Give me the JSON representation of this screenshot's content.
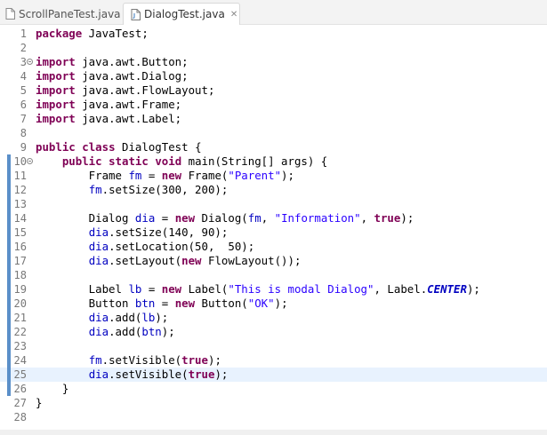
{
  "tabs": [
    {
      "label": "ScrollPaneTest.java",
      "active": false
    },
    {
      "label": "DialogTest.java",
      "active": true,
      "close_icon": "close-x-icon"
    }
  ],
  "editor": {
    "current_line": 25,
    "modified_lines": [
      10,
      26
    ],
    "folding_lines": [
      3,
      10
    ],
    "lines": [
      {
        "n": "1",
        "tokens": [
          [
            "kw",
            "package"
          ],
          [
            "p",
            " JavaTest;"
          ]
        ]
      },
      {
        "n": "2",
        "tokens": []
      },
      {
        "n": "3",
        "tokens": [
          [
            "kw",
            "import"
          ],
          [
            "p",
            " java.awt.Button;"
          ]
        ]
      },
      {
        "n": "4",
        "tokens": [
          [
            "kw",
            "import"
          ],
          [
            "p",
            " java.awt.Dialog;"
          ]
        ]
      },
      {
        "n": "5",
        "tokens": [
          [
            "kw",
            "import"
          ],
          [
            "p",
            " java.awt.FlowLayout;"
          ]
        ]
      },
      {
        "n": "6",
        "tokens": [
          [
            "kw",
            "import"
          ],
          [
            "p",
            " java.awt.Frame;"
          ]
        ]
      },
      {
        "n": "7",
        "tokens": [
          [
            "kw",
            "import"
          ],
          [
            "p",
            " java.awt.Label;"
          ]
        ]
      },
      {
        "n": "8",
        "tokens": []
      },
      {
        "n": "9",
        "tokens": [
          [
            "kw",
            "public"
          ],
          [
            "p",
            " "
          ],
          [
            "kw",
            "class"
          ],
          [
            "p",
            " DialogTest {"
          ]
        ]
      },
      {
        "n": "10",
        "tokens": [
          [
            "p",
            "    "
          ],
          [
            "kw",
            "public"
          ],
          [
            "p",
            " "
          ],
          [
            "kw",
            "static"
          ],
          [
            "p",
            " "
          ],
          [
            "kw",
            "void"
          ],
          [
            "p",
            " main(String[] args) {"
          ]
        ]
      },
      {
        "n": "11",
        "tokens": [
          [
            "p",
            "        Frame "
          ],
          [
            "fld",
            "fm"
          ],
          [
            "p",
            " = "
          ],
          [
            "kw",
            "new"
          ],
          [
            "p",
            " Frame("
          ],
          [
            "str",
            "\"Parent\""
          ],
          [
            "p",
            ");"
          ]
        ]
      },
      {
        "n": "12",
        "tokens": [
          [
            "p",
            "        "
          ],
          [
            "fld",
            "fm"
          ],
          [
            "p",
            ".setSize(300, 200);"
          ]
        ]
      },
      {
        "n": "13",
        "tokens": []
      },
      {
        "n": "14",
        "tokens": [
          [
            "p",
            "        Dialog "
          ],
          [
            "fld",
            "dia"
          ],
          [
            "p",
            " = "
          ],
          [
            "kw",
            "new"
          ],
          [
            "p",
            " Dialog("
          ],
          [
            "fld",
            "fm"
          ],
          [
            "p",
            ", "
          ],
          [
            "str",
            "\"Information\""
          ],
          [
            "p",
            ", "
          ],
          [
            "kw",
            "true"
          ],
          [
            "p",
            ");"
          ]
        ]
      },
      {
        "n": "15",
        "tokens": [
          [
            "p",
            "        "
          ],
          [
            "fld",
            "dia"
          ],
          [
            "p",
            ".setSize(140, 90);"
          ]
        ]
      },
      {
        "n": "16",
        "tokens": [
          [
            "p",
            "        "
          ],
          [
            "fld",
            "dia"
          ],
          [
            "p",
            ".setLocation(50,  50);"
          ]
        ]
      },
      {
        "n": "17",
        "tokens": [
          [
            "p",
            "        "
          ],
          [
            "fld",
            "dia"
          ],
          [
            "p",
            ".setLayout("
          ],
          [
            "kw",
            "new"
          ],
          [
            "p",
            " FlowLayout());"
          ]
        ]
      },
      {
        "n": "18",
        "tokens": []
      },
      {
        "n": "19",
        "tokens": [
          [
            "p",
            "        Label "
          ],
          [
            "fld",
            "lb"
          ],
          [
            "p",
            " = "
          ],
          [
            "kw",
            "new"
          ],
          [
            "p",
            " Label("
          ],
          [
            "str",
            "\"This is modal Dialog\""
          ],
          [
            "p",
            ", Label."
          ],
          [
            "sfld",
            "CENTER"
          ],
          [
            "p",
            ");"
          ]
        ]
      },
      {
        "n": "20",
        "tokens": [
          [
            "p",
            "        Button "
          ],
          [
            "fld",
            "btn"
          ],
          [
            "p",
            " = "
          ],
          [
            "kw",
            "new"
          ],
          [
            "p",
            " Button("
          ],
          [
            "str",
            "\"OK\""
          ],
          [
            "p",
            ");"
          ]
        ]
      },
      {
        "n": "21",
        "tokens": [
          [
            "p",
            "        "
          ],
          [
            "fld",
            "dia"
          ],
          [
            "p",
            ".add("
          ],
          [
            "fld",
            "lb"
          ],
          [
            "p",
            ");"
          ]
        ]
      },
      {
        "n": "22",
        "tokens": [
          [
            "p",
            "        "
          ],
          [
            "fld",
            "dia"
          ],
          [
            "p",
            ".add("
          ],
          [
            "fld",
            "btn"
          ],
          [
            "p",
            ");"
          ]
        ]
      },
      {
        "n": "23",
        "tokens": []
      },
      {
        "n": "24",
        "tokens": [
          [
            "p",
            "        "
          ],
          [
            "fld",
            "fm"
          ],
          [
            "p",
            ".setVisible("
          ],
          [
            "kw",
            "true"
          ],
          [
            "p",
            ");"
          ]
        ]
      },
      {
        "n": "25",
        "tokens": [
          [
            "p",
            "        "
          ],
          [
            "fld",
            "dia"
          ],
          [
            "p",
            ".setVisible("
          ],
          [
            "kw",
            "true"
          ],
          [
            "p",
            ");"
          ]
        ]
      },
      {
        "n": "26",
        "tokens": [
          [
            "p",
            "    }"
          ]
        ]
      },
      {
        "n": "27",
        "tokens": [
          [
            "p",
            "}"
          ]
        ]
      },
      {
        "n": "28",
        "tokens": []
      }
    ]
  }
}
